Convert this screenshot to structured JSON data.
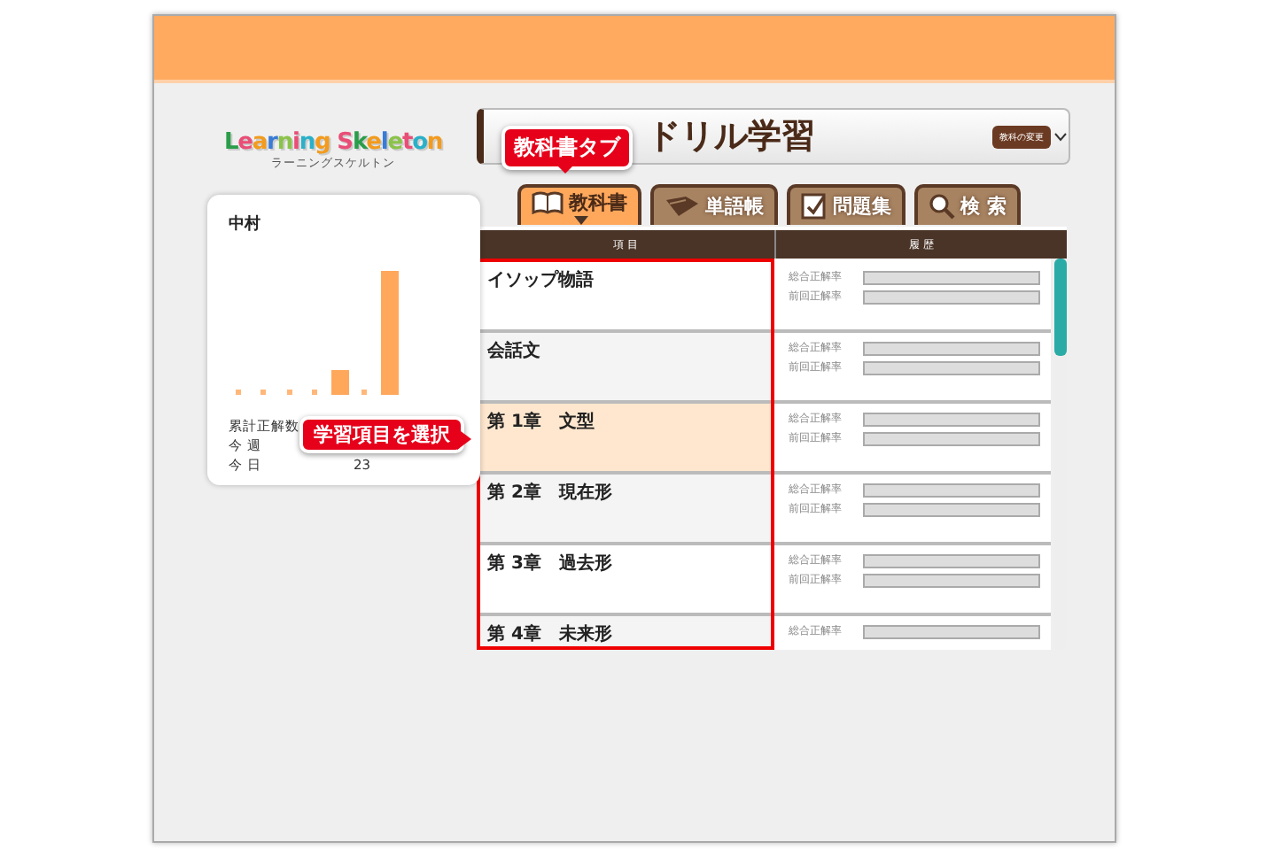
{
  "logo": {
    "name": "Learning Skeleton",
    "reading": "ラーニングスケルトン"
  },
  "user": {
    "name": "中村",
    "stats": [
      {
        "label": "累計正解数"
      },
      {
        "label": "今 週"
      },
      {
        "label": "今 日",
        "value": "23"
      }
    ]
  },
  "title": {
    "text": "ドリル学習",
    "button": "教科の変更"
  },
  "tabs": [
    {
      "label": "教科書",
      "kind": "book",
      "selected": true
    },
    {
      "label": "単語帳",
      "kind": "cards",
      "selected": false
    },
    {
      "label": "問題集",
      "kind": "notebook",
      "selected": false
    },
    {
      "label": "検 索",
      "kind": "search",
      "selected": false
    }
  ],
  "table": {
    "columns": [
      "項 目",
      "履 歴"
    ],
    "rows": [
      {
        "title": "イソップ物語",
        "selected": false,
        "rates": [
          "総合正解率",
          "前回正解率"
        ]
      },
      {
        "title": "会話文",
        "selected": false,
        "rates": [
          "総合正解率",
          "前回正解率"
        ]
      },
      {
        "title": "第 1章　文型",
        "selected": true,
        "rates": [
          "総合正解率",
          "前回正解率"
        ]
      },
      {
        "title": "第 2章　現在形",
        "selected": false,
        "rates": [
          "総合正解率",
          "前回正解率"
        ]
      },
      {
        "title": "第 3章　過去形",
        "selected": false,
        "rates": [
          "総合正解率",
          "前回正解率"
        ]
      },
      {
        "title": "第 4章　未来形",
        "selected": false,
        "rates": [
          "総合正解率"
        ]
      }
    ]
  },
  "callouts": [
    {
      "text": "教科書タブ",
      "kind": "down"
    },
    {
      "text": "学習項目を選択",
      "kind": "right"
    }
  ]
}
